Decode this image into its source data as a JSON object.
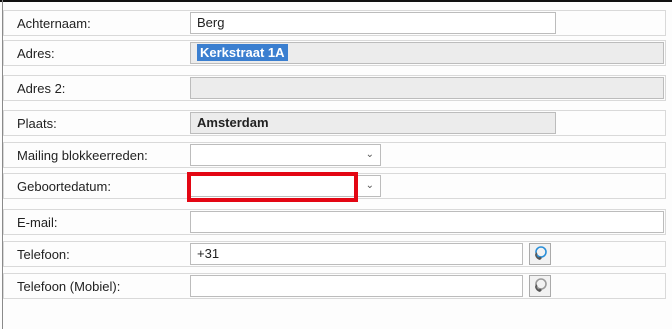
{
  "rows": [
    {
      "label": "Achternaam:",
      "value": "Berg"
    },
    {
      "label": "Adres:",
      "value": "Kerkstraat 1A"
    },
    {
      "label": "Adres 2:",
      "value": ""
    },
    {
      "label": "Plaats:",
      "value": "Amsterdam"
    },
    {
      "label": "Mailing blokkeerreden:",
      "value": ""
    },
    {
      "label": "Geboortedatum:",
      "value": ""
    },
    {
      "label": "E-mail:",
      "value": ""
    },
    {
      "label": "Telefoon:",
      "value": "+31"
    },
    {
      "label": "Telefoon (Mobiel):",
      "value": ""
    }
  ],
  "highlight_color": "#e30613",
  "selection_color": "#3b7fd0",
  "icons": {
    "dropdown": "chevron-down-icon",
    "phone": "phone-icon"
  }
}
